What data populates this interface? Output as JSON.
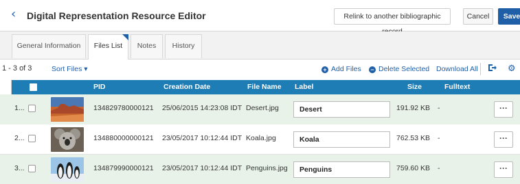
{
  "header": {
    "title": "Digital Representation Resource Editor",
    "back_icon": "chevron-left-icon",
    "relink_label": "Relink to another bibliographic record",
    "cancel_label": "Cancel",
    "save_label": "Save"
  },
  "tabs": [
    {
      "label": "General Information",
      "active": false
    },
    {
      "label": "Files List",
      "active": true
    },
    {
      "label": "Notes",
      "active": false
    },
    {
      "label": "History",
      "active": false
    }
  ],
  "toolbar": {
    "count": "1 - 3 of 3",
    "sort_label": "Sort Files",
    "sort_caret": "▾",
    "add_label": "Add Files",
    "add_icon": "+",
    "delete_label": "Delete Selected",
    "delete_icon": "−",
    "download_label": "Download All",
    "export_icon": "export-icon",
    "settings_icon": "gear-icon"
  },
  "table": {
    "columns": [
      "PID",
      "Creation Date",
      "File Name",
      "Label",
      "Size",
      "Fulltext"
    ],
    "rows": [
      {
        "num": "1...",
        "pid": "134829780000121",
        "date": "25/06/2015 14:23:08 IDT",
        "file": "Desert.jpg",
        "label": "Desert",
        "size": "191.92 KB",
        "fulltext": "-",
        "more": "···"
      },
      {
        "num": "2...",
        "pid": "134880000000121",
        "date": "23/05/2017 10:12:44 IDT",
        "file": "Koala.jpg",
        "label": "Koala",
        "size": "762.53 KB",
        "fulltext": "-",
        "more": "···"
      },
      {
        "num": "3...",
        "pid": "134879990000121",
        "date": "23/05/2017 10:12:44 IDT",
        "file": "Penguins.jpg",
        "label": "Penguins",
        "size": "759.60 KB",
        "fulltext": "-",
        "more": "···"
      }
    ]
  },
  "colors": {
    "primary": "#1f5fa8",
    "table_header": "#1f7db5",
    "row_highlight": "#e9f2e8"
  }
}
